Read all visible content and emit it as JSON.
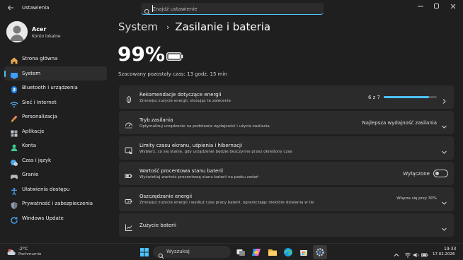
{
  "window": {
    "app_title": "Ustawienia",
    "back_icon": "back-arrow-icon",
    "minimize_icon": "minimize-icon",
    "maximize_icon": "maximize-icon",
    "close_icon": "close-icon"
  },
  "search": {
    "placeholder": "Znajdź ustawienie",
    "value": ""
  },
  "profile": {
    "name": "Acer",
    "subtitle": "Konto lokalne"
  },
  "sidebar": {
    "items": [
      {
        "label": "Strona główna",
        "icon": "home-icon",
        "active": false
      },
      {
        "label": "System",
        "icon": "system-icon",
        "active": true
      },
      {
        "label": "Bluetooth i urządzenia",
        "icon": "bluetooth-icon",
        "active": false
      },
      {
        "label": "Sieć i Internet",
        "icon": "wifi-icon",
        "active": false
      },
      {
        "label": "Personalizacja",
        "icon": "brush-icon",
        "active": false
      },
      {
        "label": "Aplikacje",
        "icon": "apps-icon",
        "active": false
      },
      {
        "label": "Konta",
        "icon": "person-icon",
        "active": false
      },
      {
        "label": "Czas i język",
        "icon": "globe-clock-icon",
        "active": false
      },
      {
        "label": "Granie",
        "icon": "gamepad-icon",
        "active": false
      },
      {
        "label": "Ułatwienia dostępu",
        "icon": "accessibility-icon",
        "active": false
      },
      {
        "label": "Prywatność i zabezpieczenia",
        "icon": "shield-icon",
        "active": false
      },
      {
        "label": "Windows Update",
        "icon": "update-icon",
        "active": false
      }
    ]
  },
  "breadcrumb": {
    "parent": "System",
    "separator": "›",
    "current": "Zasilanie i bateria"
  },
  "battery": {
    "percent_label": "99%",
    "level": 0.99,
    "estimate": "Szacowany pozostały czas: 13 godz. 15 min"
  },
  "cards": {
    "recommendations": {
      "title": "Rekomendacje dotyczące energii",
      "subtitle": "Zmniejsz zużycie energii, stosując te zalecenia",
      "progress_text": "6 z 7",
      "progress": 0.857,
      "icon": "leaf-icon"
    },
    "power_mode": {
      "title": "Tryb zasilania",
      "subtitle": "Optymalizuj urządzenie na podstawie wydajności i użycia zasilania",
      "value": "Najlepsza wydajność zasilania",
      "icon": "power-mode-icon"
    },
    "screen_timeout": {
      "title": "Limity czasu ekranu, uśpienia i hibernacji",
      "subtitle": "Wybierz, co się stanie, gdy urządzenie będzie bezczynne przez określony czas",
      "icon": "screen-sleep-icon"
    },
    "battery_percent": {
      "title": "Wartość procentowa stanu baterii",
      "subtitle": "Wyświetlaj wartość procentową stanu baterii na pasku zadań",
      "toggle_label": "Wyłączone",
      "toggle_on": false,
      "icon": "battery-percent-icon"
    },
    "energy_saver": {
      "title": "Oszczędzanie energii",
      "subtitle": "Zmniejsz zużycie energii i wydłuż czas pracy baterii, ograniczając niektóre działania w tle",
      "value": "Włącza się przy 30%",
      "icon": "energy-saver-icon"
    },
    "battery_usage": {
      "title": "Zużycie baterii",
      "icon": "chart-icon"
    }
  },
  "taskbar": {
    "weather_temp": "-2°C",
    "weather_desc": "Pochmurnie",
    "search_label": "Wyszukaj",
    "clock_time": "19:33",
    "clock_date": "17.02.2026",
    "pinned": [
      "windows-start-icon",
      "task-view-icon",
      "copilot-icon",
      "file-explorer-icon",
      "edge-icon",
      "store-icon",
      "settings-icon"
    ]
  },
  "colors": {
    "accent": "#4cc2ff",
    "background": "#1f1f1f",
    "card": "#2b2b2b"
  }
}
